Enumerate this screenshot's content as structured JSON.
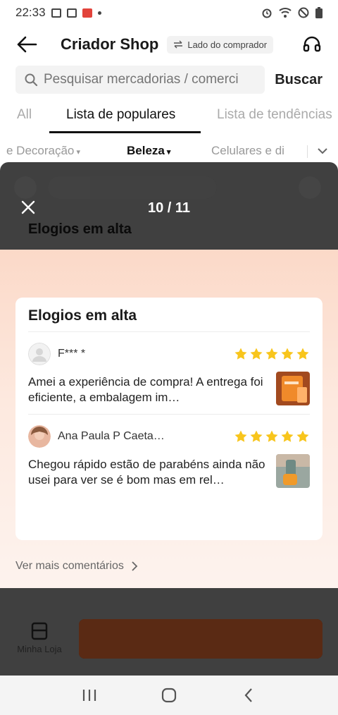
{
  "status_bar": {
    "time": "22:33"
  },
  "header": {
    "title": "Criador Shop",
    "buyer_side": "Lado do comprador"
  },
  "search": {
    "placeholder": "Pesquisar mercadorias / comerci",
    "button": "Buscar"
  },
  "tabs": [
    {
      "label": "All"
    },
    {
      "label": "Lista de populares"
    },
    {
      "label": "Lista de tendências"
    }
  ],
  "categories": [
    {
      "label": "e Decoração"
    },
    {
      "label": "Beleza"
    },
    {
      "label": "Celulares e di"
    }
  ],
  "background_page": {
    "card_title": "Elogios em alta",
    "my_store": "Minha Loja"
  },
  "viewer": {
    "counter": "10 / 11"
  },
  "praise_card": {
    "title": "Elogios em alta",
    "reviews": [
      {
        "name": "F*** *",
        "rating": 5,
        "text": "Amei a experiência de compra! A entrega foi eficiente, a embalagem impecável",
        "display_text": "Amei a experiência de compra! A entrega foi eficiente, a embalagem im…"
      },
      {
        "name": "Ana Paula P Caeta…",
        "rating": 5,
        "text": "Chegou rápido estão de parabéns ainda não usei para ver se é bom mas em relação",
        "display_text": "Chegou rápido estão de parabéns ainda não usei para ver se é bom mas em rel…"
      }
    ],
    "see_more": "Ver mais comentários"
  },
  "colors": {
    "star": "#f8c51c",
    "accent_orange": "#e86a2a"
  }
}
